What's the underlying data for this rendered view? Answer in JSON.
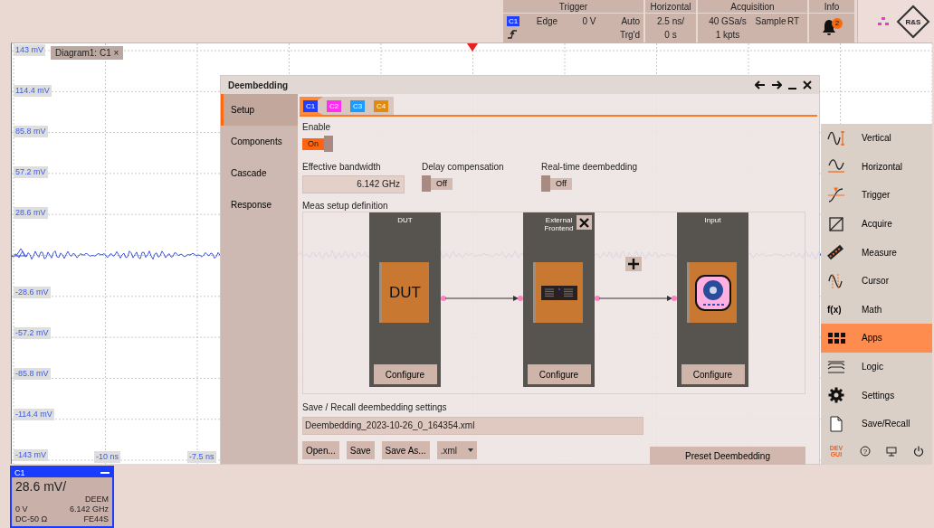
{
  "top_bar": {
    "trigger": {
      "title": "Trigger",
      "source": {
        "label": "C1",
        "color": "#1f3fff"
      },
      "type": "Edge",
      "level": "0 V",
      "mode": "Auto",
      "state": "Trg'd"
    },
    "horizontal": {
      "title": "Horizontal",
      "scale": "2.5 ns/",
      "position": "0 s"
    },
    "acquisition": {
      "title": "Acquisition",
      "rate": "40 GSa/s",
      "mode": "Sample",
      "type": "RT",
      "length": "1 kpts"
    },
    "info": {
      "title": "Info",
      "count": "2"
    },
    "logo": {
      "text": "R&S"
    }
  },
  "diagram": {
    "tab": {
      "label": "Diagram1: C1",
      "close": "×"
    },
    "y_labels": [
      "143 mV",
      "114.4 mV",
      "85.8 mV",
      "57.2 mV",
      "28.6 mV",
      "-28.6 mV",
      "-57.2 mV",
      "-85.8 mV",
      "-114.4 mV",
      "-143 mV"
    ],
    "x_labels": [
      "-10 ns",
      "-7.5 ns"
    ]
  },
  "dialog": {
    "title": "Deembedding",
    "nav": [
      {
        "label": "Setup",
        "selected": true
      },
      {
        "label": "Components",
        "selected": false
      },
      {
        "label": "Cascade",
        "selected": false
      },
      {
        "label": "Response",
        "selected": false
      }
    ],
    "channel_tabs": [
      {
        "label": "C1",
        "color": "#1f3fff",
        "selected": true
      },
      {
        "label": "C2",
        "color": "#ff2ef0",
        "selected": false
      },
      {
        "label": "C3",
        "color": "#1e9bff",
        "selected": false
      },
      {
        "label": "C4",
        "color": "#e08a10",
        "selected": false
      }
    ],
    "enable": {
      "label": "Enable",
      "on": true,
      "text": "On"
    },
    "bandwidth": {
      "label": "Effective bandwidth",
      "value": "6.142 GHz"
    },
    "toggles": [
      {
        "label": "Delay compensation",
        "on": false,
        "text": "Off"
      },
      {
        "label": "Real-time deembedding",
        "on": false,
        "text": "Off"
      }
    ],
    "setup_label": "Meas setup definition",
    "blocks": [
      {
        "kind": "dut",
        "title": "DUT",
        "card_text": "DUT",
        "removable": false,
        "button": "Configure"
      },
      {
        "kind": "frontend",
        "title": "External Frontend",
        "removable": true,
        "button": "Configure"
      },
      {
        "kind": "input",
        "title": "Input",
        "removable": false,
        "button": "Configure"
      }
    ],
    "save_label": "Save / Recall deembedding settings",
    "file": "Deembedding_2023-10-26_0_164354.xml",
    "buttons": [
      "Open...",
      "Save",
      "Save As..."
    ],
    "format": ".xml",
    "preset_button": "Preset Deembedding"
  },
  "side_menu": {
    "items": [
      {
        "kind": "vertical",
        "label": "Vertical",
        "selected": false
      },
      {
        "kind": "horizontal",
        "label": "Horizontal",
        "selected": false
      },
      {
        "kind": "trigger",
        "label": "Trigger",
        "selected": false
      },
      {
        "kind": "acquire",
        "label": "Acquire",
        "selected": false
      },
      {
        "kind": "measure",
        "label": "Measure",
        "selected": false
      },
      {
        "kind": "cursor",
        "label": "Cursor",
        "selected": false
      },
      {
        "kind": "math",
        "glyph": "f(x)",
        "label": "Math",
        "selected": false
      },
      {
        "kind": "apps",
        "label": "Apps",
        "selected": true
      },
      {
        "kind": "logic",
        "label": "Logic",
        "selected": false
      },
      {
        "kind": "settings",
        "label": "Settings",
        "selected": false
      },
      {
        "kind": "save",
        "label": "Save/Recall",
        "selected": false
      }
    ],
    "dev_label": "DEV GUI",
    "help_glyph": "?"
  },
  "channel_box": {
    "title": "C1",
    "scale": "28.6 mV/",
    "mode": "DEEM",
    "offset": "0 V",
    "bandwidth": "6.142 GHz",
    "coupling": "DC-50 Ω",
    "frontend": "FE44S"
  }
}
